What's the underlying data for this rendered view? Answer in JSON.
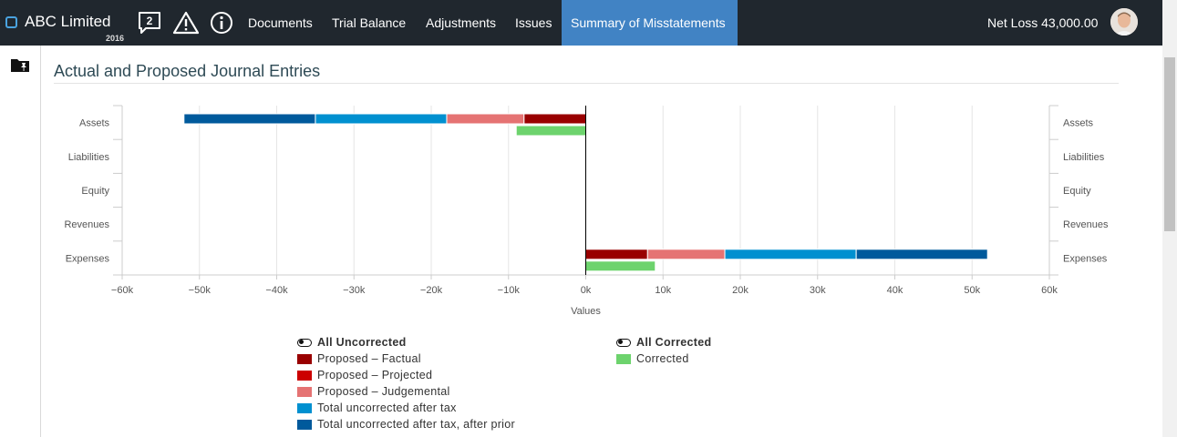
{
  "app": {
    "name": "ABC Limited",
    "year": "2016"
  },
  "header": {
    "comments_count": "2",
    "nav": [
      {
        "label": "Documents"
      },
      {
        "label": "Trial Balance"
      },
      {
        "label": "Adjustments"
      },
      {
        "label": "Issues"
      },
      {
        "label": "Summary of Misstatements",
        "active": true
      }
    ],
    "net_loss": "Net Loss 43,000.00"
  },
  "page": {
    "title": "Actual and Proposed Journal Entries"
  },
  "chart_data": {
    "type": "bar",
    "orientation": "horizontal",
    "categories": [
      "Assets",
      "Liabilities",
      "Equity",
      "Revenues",
      "Expenses"
    ],
    "xlabel": "Values",
    "xlim": [
      -60000,
      60000
    ],
    "xticks": [
      -60000,
      -50000,
      -40000,
      -30000,
      -20000,
      -10000,
      0,
      10000,
      20000,
      30000,
      40000,
      50000,
      60000
    ],
    "xtick_labels": [
      "−60k",
      "−50k",
      "−40k",
      "−30k",
      "−20k",
      "−10k",
      "0k",
      "10k",
      "20k",
      "30k",
      "40k",
      "50k",
      "60k"
    ],
    "grid": true,
    "stacks": [
      "uncorrected",
      "corrected"
    ],
    "series": [
      {
        "name": "Proposed – Factual",
        "stack": "uncorrected",
        "color": "#990000",
        "values": [
          -8000,
          0,
          0,
          0,
          8000
        ]
      },
      {
        "name": "Proposed – Projected",
        "stack": "uncorrected",
        "color": "#cc0000",
        "values": [
          0,
          0,
          0,
          0,
          0
        ]
      },
      {
        "name": "Proposed – Judgemental",
        "stack": "uncorrected",
        "color": "#e57373",
        "values": [
          -10000,
          0,
          0,
          0,
          10000
        ]
      },
      {
        "name": "Total uncorrected after tax",
        "stack": "uncorrected",
        "color": "#0090d0",
        "values": [
          -17000,
          0,
          0,
          0,
          17000
        ]
      },
      {
        "name": "Total uncorrected after tax, after prior",
        "stack": "uncorrected",
        "color": "#005a9c",
        "values": [
          -17000,
          0,
          0,
          0,
          17000
        ]
      },
      {
        "name": "Corrected",
        "stack": "corrected",
        "color": "#6dd36d",
        "values": [
          -9000,
          0,
          0,
          0,
          9000
        ]
      }
    ],
    "legend": {
      "groups": [
        {
          "title": "All Uncorrected",
          "items": [
            "Proposed – Factual",
            "Proposed – Projected",
            "Proposed – Judgemental",
            "Total uncorrected after tax",
            "Total uncorrected after tax, after prior"
          ]
        },
        {
          "title": "All Corrected",
          "items": [
            "Corrected"
          ]
        }
      ]
    }
  }
}
